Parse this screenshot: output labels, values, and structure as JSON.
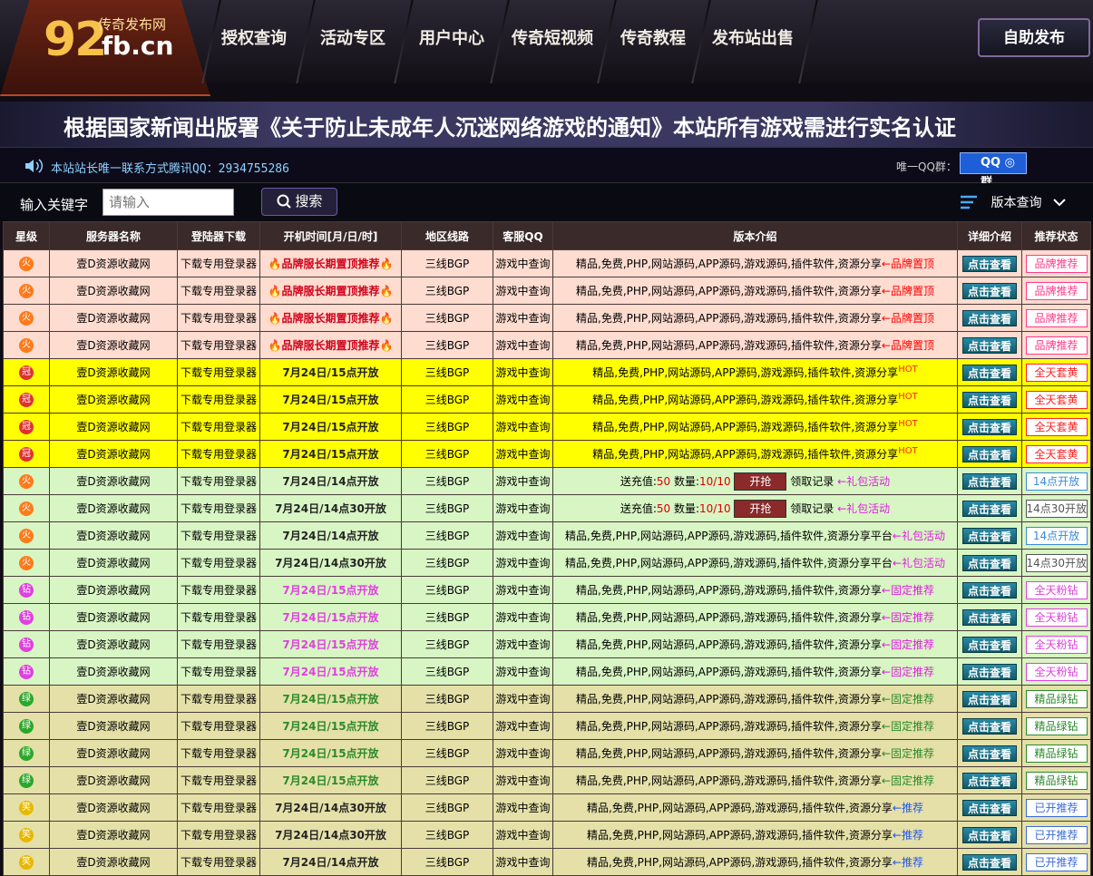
{
  "logo": {
    "big": "92",
    "domain": "fb.cn",
    "sub": "传奇发布网"
  },
  "nav": [
    "授权查询",
    "活动专区",
    "用户中心",
    "传奇短视频",
    "传奇教程",
    "发布站出售"
  ],
  "publish_label": "自助发布",
  "notice": "根据国家新闻出版署《关于防止未成年人沉迷网络游戏的通知》本站所有游戏需进行实名认证",
  "contact": {
    "text": "本站站长唯一联系方式腾讯QQ：2934755286",
    "qq_group_label": "唯一QQ群：",
    "qq_badge": "QQ ◎ 群"
  },
  "search": {
    "label": "输入关键字",
    "placeholder": "请输入",
    "button": "搜索",
    "version": "版本查询"
  },
  "headers": [
    "星级",
    "服务器名称",
    "登陆器下载",
    "开机时间[月/日/时]",
    "地区线路",
    "客服QQ",
    "版本介绍",
    "详细介绍",
    "推荐状态"
  ],
  "common": {
    "name": "壹D资源收藏网",
    "download": "下载专用登录器",
    "line": "三线BGP",
    "qq": "游戏中查询",
    "detail": "点击查看"
  },
  "rows": [
    {
      "cls": "r-brand",
      "star": "火",
      "time": "🔥品牌服长期置顶推荐🔥",
      "desc": "精品,免费,PHP,网站源码,APP源码,游戏源码,插件软件,资源分享",
      "suffix": "←品牌置顶",
      "status": "品牌推荐",
      "statusColor": "#ff3a8a"
    },
    {
      "cls": "r-brand",
      "star": "火",
      "time": "🔥品牌服长期置顶推荐🔥",
      "desc": "精品,免费,PHP,网站源码,APP源码,游戏源码,插件软件,资源分享",
      "suffix": "←品牌置顶",
      "status": "品牌推荐",
      "statusColor": "#ff3a8a"
    },
    {
      "cls": "r-brand",
      "star": "火",
      "time": "🔥品牌服长期置顶推荐🔥",
      "desc": "精品,免费,PHP,网站源码,APP源码,游戏源码,插件软件,资源分享",
      "suffix": "←品牌置顶",
      "status": "品牌推荐",
      "statusColor": "#ff3a8a"
    },
    {
      "cls": "r-brand",
      "star": "火",
      "time": "🔥品牌服长期置顶推荐🔥",
      "desc": "精品,免费,PHP,网站源码,APP源码,游戏源码,插件软件,资源分享",
      "suffix": "←品牌置顶",
      "status": "品牌推荐",
      "statusColor": "#ff3a8a"
    },
    {
      "cls": "r-yellow",
      "star": "冠",
      "time": "7月24日/15点开放",
      "desc": "精品,免费,PHP,网站源码,APP源码,游戏源码,插件软件,资源分享",
      "suffix": "HOT",
      "status": "全天套黄",
      "statusColor": "#ff2222"
    },
    {
      "cls": "r-yellow",
      "star": "冠",
      "time": "7月24日/15点开放",
      "desc": "精品,免费,PHP,网站源码,APP源码,游戏源码,插件软件,资源分享",
      "suffix": "HOT",
      "status": "全天套黄",
      "statusColor": "#ff2222"
    },
    {
      "cls": "r-yellow",
      "star": "冠",
      "time": "7月24日/15点开放",
      "desc": "精品,免费,PHP,网站源码,APP源码,游戏源码,插件软件,资源分享",
      "suffix": "HOT",
      "status": "全天套黄",
      "statusColor": "#ff2222"
    },
    {
      "cls": "r-yellow",
      "star": "冠",
      "time": "7月24日/15点开放",
      "desc": "精品,免费,PHP,网站源码,APP源码,游戏源码,插件软件,资源分享",
      "suffix": "HOT",
      "status": "全天套黄",
      "statusColor": "#ff2222"
    },
    {
      "cls": "r-green",
      "star": "火",
      "time": "7月24日/14点开放",
      "gift": true,
      "status": "14点开放",
      "statusColor": "#3a8ad8"
    },
    {
      "cls": "r-green",
      "star": "火",
      "time": "7月24日/14点30开放",
      "gift": true,
      "status": "14点30开放",
      "statusColor": "#555555"
    },
    {
      "cls": "r-green",
      "star": "火",
      "time": "7月24日/14点开放",
      "desc": "精品,免费,PHP,网站源码,APP源码,游戏源码,插件软件,资源分享平台",
      "suffix": "←礼包活动",
      "status": "14点开放",
      "statusColor": "#3a8ad8"
    },
    {
      "cls": "r-green",
      "star": "火",
      "time": "7月24日/14点30开放",
      "desc": "精品,免费,PHP,网站源码,APP源码,游戏源码,插件软件,资源分享平台",
      "suffix": "←礼包活动",
      "status": "14点30开放",
      "statusColor": "#555555"
    },
    {
      "cls": "r-green",
      "star": "钻",
      "time": "7月24日/15点开放",
      "desc": "精品,免费,PHP,网站源码,APP源码,游戏源码,插件软件,资源分享",
      "suffix": "←固定推荐",
      "status": "全天粉钻",
      "statusColor": "#e040e0"
    },
    {
      "cls": "r-green",
      "star": "钻",
      "time": "7月24日/15点开放",
      "desc": "精品,免费,PHP,网站源码,APP源码,游戏源码,插件软件,资源分享",
      "suffix": "←固定推荐",
      "status": "全天粉钻",
      "statusColor": "#e040e0"
    },
    {
      "cls": "r-green",
      "star": "钻",
      "time": "7月24日/15点开放",
      "desc": "精品,免费,PHP,网站源码,APP源码,游戏源码,插件软件,资源分享",
      "suffix": "←固定推荐",
      "status": "全天粉钻",
      "statusColor": "#e040e0"
    },
    {
      "cls": "r-green",
      "star": "钻",
      "time": "7月24日/15点开放",
      "desc": "精品,免费,PHP,网站源码,APP源码,游戏源码,插件软件,资源分享",
      "suffix": "←固定推荐",
      "status": "全天粉钻",
      "statusColor": "#e040e0"
    },
    {
      "cls": "r-olive",
      "star": "绿",
      "time": "7月24日/15点开放",
      "desc": "精品,免费,PHP,网站源码,APP源码,游戏源码,插件软件,资源分享",
      "suffix": "←固定推荐",
      "status": "精品绿钻",
      "statusColor": "#2a8a2a"
    },
    {
      "cls": "r-olive",
      "star": "绿",
      "time": "7月24日/15点开放",
      "desc": "精品,免费,PHP,网站源码,APP源码,游戏源码,插件软件,资源分享",
      "suffix": "←固定推荐",
      "status": "精品绿钻",
      "statusColor": "#2a8a2a"
    },
    {
      "cls": "r-olive",
      "star": "绿",
      "time": "7月24日/15点开放",
      "desc": "精品,免费,PHP,网站源码,APP源码,游戏源码,插件软件,资源分享",
      "suffix": "←固定推荐",
      "status": "精品绿钻",
      "statusColor": "#2a8a2a"
    },
    {
      "cls": "r-olive",
      "star": "绿",
      "time": "7月24日/15点开放",
      "desc": "精品,免费,PHP,网站源码,APP源码,游戏源码,插件软件,资源分享",
      "suffix": "←固定推荐",
      "status": "精品绿钻",
      "statusColor": "#2a8a2a"
    },
    {
      "cls": "r-olive",
      "star": "笑",
      "time": "7月24日/14点30开放",
      "desc": "精品,免费,PHP,网站源码,APP源码,游戏源码,插件软件,资源分享",
      "suffix": "←推荐",
      "status": "已开推荐",
      "statusColor": "#3a6ad8"
    },
    {
      "cls": "r-olive",
      "star": "笑",
      "time": "7月24日/14点30开放",
      "desc": "精品,免费,PHP,网站源码,APP源码,游戏源码,插件软件,资源分享",
      "suffix": "←推荐",
      "status": "已开推荐",
      "statusColor": "#3a6ad8"
    },
    {
      "cls": "r-olive",
      "star": "笑",
      "time": "7月24日/14点开放",
      "desc": "精品,免费,PHP,网站源码,APP源码,游戏源码,插件软件,资源分享",
      "suffix": "←推荐",
      "status": "已开推荐",
      "statusColor": "#3a6ad8"
    }
  ],
  "gift": {
    "label": "送充值:",
    "amount": "50",
    "qty_label": "数量:",
    "qty": "10/10",
    "grab": "开抢",
    "record": "领取记录",
    "suffix": "←礼包活动"
  },
  "colors": {
    "star_fire": "#ff7a1a",
    "star_crown": "#e03030",
    "star_pink": "#e040e0",
    "star_green": "#2aa82a",
    "star_smile": "#e8b800"
  }
}
